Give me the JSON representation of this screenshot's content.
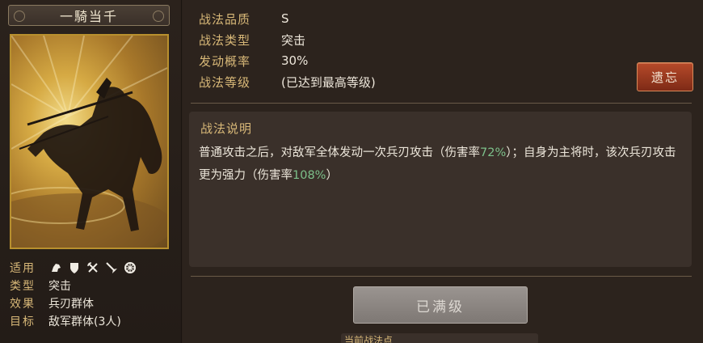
{
  "skill": {
    "name": "一騎当千",
    "quality_label": "战法品质",
    "quality_value": "S",
    "type_label": "战法类型",
    "type_value": "突击",
    "chance_label": "发动概率",
    "chance_value": "30%",
    "level_label": "战法等级",
    "level_value": "(已达到最高等级)"
  },
  "attributes": {
    "troops_label": "适用",
    "troop_icons": [
      "cavalry-icon",
      "shield-icon",
      "bow-icon",
      "spear-icon",
      "wheel-icon"
    ],
    "type_label": "类型",
    "type_value": "突击",
    "effect_label": "效果",
    "effect_value": "兵刃群体",
    "target_label": "目标",
    "target_value": "敌军群体(3人)"
  },
  "buttons": {
    "forget": "遗忘",
    "maxed": "已满级"
  },
  "description": {
    "title": "战法说明",
    "part1": "普通攻击之后，对敌军全体发动一次兵刃攻击（伤害率",
    "rate1": "72%",
    "part2": "）；自身为主将时，该次兵刃攻击更为强力（伤害率",
    "rate2": "108%",
    "part3": "）"
  },
  "bottom": {
    "partial_label": "当前战法点"
  },
  "colors": {
    "label_gold": "#d8b878",
    "highlight_green": "#7cc08a",
    "forget_red": "#9a3a20"
  }
}
